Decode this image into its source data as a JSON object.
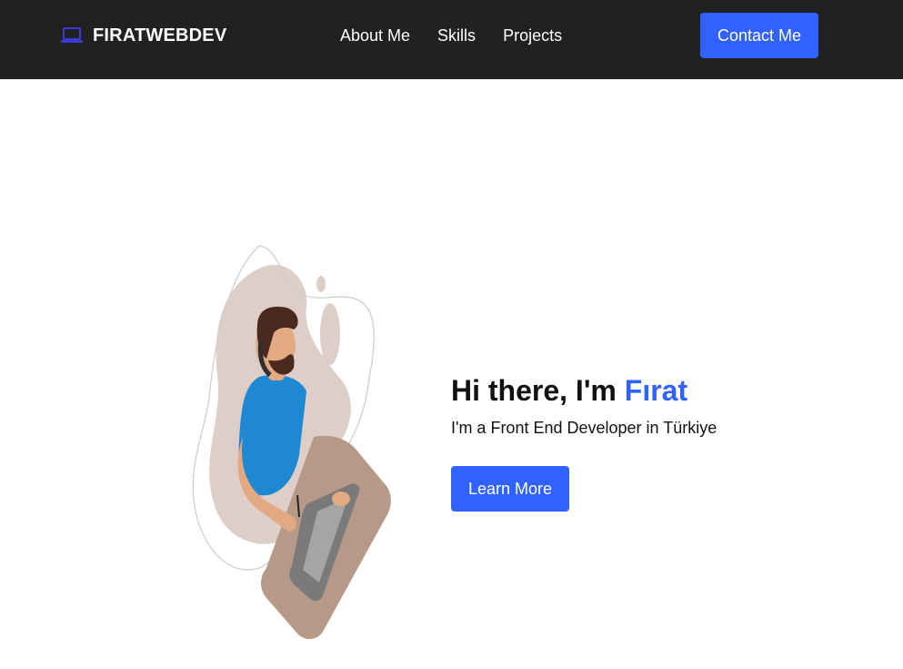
{
  "navbar": {
    "brand": {
      "icon": "laptop-icon",
      "text": "FIRATWEBDEV"
    },
    "links": [
      {
        "label": "About Me"
      },
      {
        "label": "Skills"
      },
      {
        "label": "Projects"
      }
    ],
    "contact_label": "Contact Me"
  },
  "hero": {
    "title_prefix": "Hi there, I'm ",
    "title_name": "Fırat",
    "subtitle": "I'm a Front End Developer in Türkiye",
    "button_label": "Learn More",
    "illustration": "developer-at-laptop-illustration"
  },
  "colors": {
    "navbar_bg": "#212121",
    "accent": "#2f62ff",
    "brand_icon": "#3a3ad6",
    "text": "#111111",
    "background": "#ffffff"
  }
}
